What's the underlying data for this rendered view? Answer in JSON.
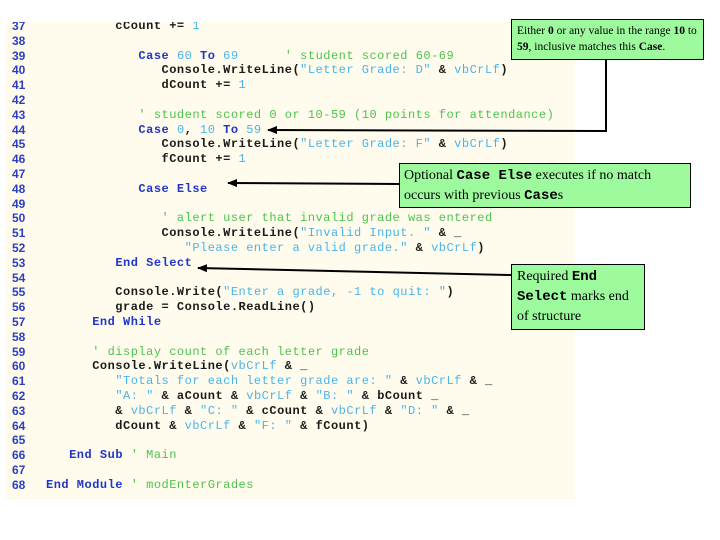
{
  "code": {
    "lines": [
      {
        "n": "37",
        "tokens": [
          {
            "k": "p",
            "t": "         cCount += "
          },
          {
            "k": "s",
            "t": "1"
          }
        ]
      },
      {
        "n": "38",
        "tokens": []
      },
      {
        "n": "39",
        "tokens": [
          {
            "k": "p",
            "t": "            "
          },
          {
            "k": "k",
            "t": "Case "
          },
          {
            "k": "s",
            "t": "60 "
          },
          {
            "k": "k",
            "t": "To "
          },
          {
            "k": "s",
            "t": "69"
          },
          {
            "k": "c",
            "t": "      ' student scored 60-69"
          }
        ]
      },
      {
        "n": "40",
        "tokens": [
          {
            "k": "p",
            "t": "               Console.WriteLine("
          },
          {
            "k": "s",
            "t": "\"Letter Grade: D\""
          },
          {
            "k": "p",
            "t": " & "
          },
          {
            "k": "s",
            "t": "vbCrLf"
          },
          {
            "k": "p",
            "t": ")"
          }
        ]
      },
      {
        "n": "41",
        "tokens": [
          {
            "k": "p",
            "t": "               dCount += "
          },
          {
            "k": "s",
            "t": "1"
          }
        ]
      },
      {
        "n": "42",
        "tokens": []
      },
      {
        "n": "43",
        "tokens": [
          {
            "k": "c",
            "t": "            ' student scored 0 or 10-59 (10 points for attendance)"
          }
        ]
      },
      {
        "n": "44",
        "tokens": [
          {
            "k": "p",
            "t": "            "
          },
          {
            "k": "k",
            "t": "Case "
          },
          {
            "k": "s",
            "t": "0"
          },
          {
            "k": "p",
            "t": ", "
          },
          {
            "k": "s",
            "t": "10 "
          },
          {
            "k": "k",
            "t": "To "
          },
          {
            "k": "s",
            "t": "59"
          }
        ]
      },
      {
        "n": "45",
        "tokens": [
          {
            "k": "p",
            "t": "               Console.WriteLine("
          },
          {
            "k": "s",
            "t": "\"Letter Grade: F\""
          },
          {
            "k": "p",
            "t": " & "
          },
          {
            "k": "s",
            "t": "vbCrLf"
          },
          {
            "k": "p",
            "t": ")"
          }
        ]
      },
      {
        "n": "46",
        "tokens": [
          {
            "k": "p",
            "t": "               fCount += "
          },
          {
            "k": "s",
            "t": "1"
          }
        ]
      },
      {
        "n": "47",
        "tokens": []
      },
      {
        "n": "48",
        "tokens": [
          {
            "k": "p",
            "t": "            "
          },
          {
            "k": "k",
            "t": "Case Else"
          }
        ]
      },
      {
        "n": "49",
        "tokens": []
      },
      {
        "n": "50",
        "tokens": [
          {
            "k": "c",
            "t": "               ' alert user that invalid grade was entered"
          }
        ]
      },
      {
        "n": "51",
        "tokens": [
          {
            "k": "p",
            "t": "               Console.WriteLine("
          },
          {
            "k": "s",
            "t": "\"Invalid Input. \""
          },
          {
            "k": "p",
            "t": " & _"
          }
        ]
      },
      {
        "n": "52",
        "tokens": [
          {
            "k": "p",
            "t": "                  "
          },
          {
            "k": "s",
            "t": "\"Please enter a valid grade.\""
          },
          {
            "k": "p",
            "t": " & "
          },
          {
            "k": "s",
            "t": "vbCrLf"
          },
          {
            "k": "p",
            "t": ")"
          }
        ]
      },
      {
        "n": "53",
        "tokens": [
          {
            "k": "p",
            "t": "         "
          },
          {
            "k": "k",
            "t": "End Select"
          }
        ]
      },
      {
        "n": "54",
        "tokens": []
      },
      {
        "n": "55",
        "tokens": [
          {
            "k": "p",
            "t": "         Console.Write("
          },
          {
            "k": "s",
            "t": "\"Enter a grade, -1 to quit: \""
          },
          {
            "k": "p",
            "t": ")"
          }
        ]
      },
      {
        "n": "56",
        "tokens": [
          {
            "k": "p",
            "t": "         grade = Console.ReadLine()"
          }
        ]
      },
      {
        "n": "57",
        "tokens": [
          {
            "k": "p",
            "t": "      "
          },
          {
            "k": "k",
            "t": "End While"
          }
        ]
      },
      {
        "n": "58",
        "tokens": []
      },
      {
        "n": "59",
        "tokens": [
          {
            "k": "c",
            "t": "      ' display count of each letter grade"
          }
        ]
      },
      {
        "n": "60",
        "tokens": [
          {
            "k": "p",
            "t": "      Console.WriteLine("
          },
          {
            "k": "s",
            "t": "vbCrLf"
          },
          {
            "k": "p",
            "t": " & _"
          }
        ]
      },
      {
        "n": "61",
        "tokens": [
          {
            "k": "p",
            "t": "         "
          },
          {
            "k": "s",
            "t": "\"Totals for each letter grade are: \""
          },
          {
            "k": "p",
            "t": " & "
          },
          {
            "k": "s",
            "t": "vbCrLf"
          },
          {
            "k": "p",
            "t": " & _"
          }
        ]
      },
      {
        "n": "62",
        "tokens": [
          {
            "k": "p",
            "t": "         "
          },
          {
            "k": "s",
            "t": "\"A: \""
          },
          {
            "k": "p",
            "t": " & aCount & "
          },
          {
            "k": "s",
            "t": "vbCrLf"
          },
          {
            "k": "p",
            "t": " & "
          },
          {
            "k": "s",
            "t": "\"B: \""
          },
          {
            "k": "p",
            "t": " & bCount _"
          }
        ]
      },
      {
        "n": "63",
        "tokens": [
          {
            "k": "p",
            "t": "         & "
          },
          {
            "k": "s",
            "t": "vbCrLf"
          },
          {
            "k": "p",
            "t": " & "
          },
          {
            "k": "s",
            "t": "\"C: \""
          },
          {
            "k": "p",
            "t": " & cCount & "
          },
          {
            "k": "s",
            "t": "vbCrLf"
          },
          {
            "k": "p",
            "t": " & "
          },
          {
            "k": "s",
            "t": "\"D: \""
          },
          {
            "k": "p",
            "t": " & _"
          }
        ]
      },
      {
        "n": "64",
        "tokens": [
          {
            "k": "p",
            "t": "         dCount & "
          },
          {
            "k": "s",
            "t": "vbCrLf"
          },
          {
            "k": "p",
            "t": " & "
          },
          {
            "k": "s",
            "t": "\"F: \""
          },
          {
            "k": "p",
            "t": " & fCount)"
          }
        ]
      },
      {
        "n": "65",
        "tokens": []
      },
      {
        "n": "66",
        "tokens": [
          {
            "k": "p",
            "t": "   "
          },
          {
            "k": "k",
            "t": "End Sub"
          },
          {
            "k": "c",
            "t": " ' Main"
          }
        ]
      },
      {
        "n": "67",
        "tokens": []
      },
      {
        "n": "68",
        "tokens": [
          {
            "k": "k",
            "t": "End Module"
          },
          {
            "k": "c",
            "t": " ' modEnterGrades"
          }
        ]
      }
    ]
  },
  "callouts": {
    "case_range": {
      "p1": "Either ",
      "b1": "0",
      "p2": " or any value in the range ",
      "b2": "10",
      "p3": " to ",
      "b3": "59",
      "p4": ", inclusive matches this ",
      "b4": "Case",
      "p5": "."
    },
    "case_else": {
      "p1": "Optional ",
      "m1": "Case Else",
      "p2": " executes if no match occurs with previous ",
      "m2": "Case",
      "p3": "s"
    },
    "end_select": {
      "p1": "Required ",
      "m1": "End Select",
      "p2": " marks end of structure"
    }
  },
  "colors": {
    "keyword": "#2036c8",
    "string": "#48b4ea",
    "comment": "#4cc44c",
    "callout_bg": "#9dfb9d",
    "panel_bg": "#fffcee"
  }
}
